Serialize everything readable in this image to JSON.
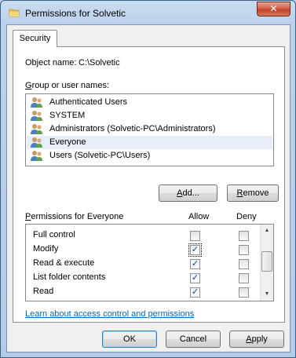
{
  "window": {
    "title": "Permissions for Solvetic",
    "close_glyph": "✕"
  },
  "tabs": [
    {
      "label": "Security"
    }
  ],
  "object": {
    "label": "Object name:",
    "value": "C:\\Solvetic"
  },
  "groups": {
    "label": "Group or user names:",
    "items": [
      {
        "label": "Authenticated Users",
        "icon": "users-icon",
        "selected": false
      },
      {
        "label": "SYSTEM",
        "icon": "users-icon",
        "selected": false
      },
      {
        "label": "Administrators (Solvetic-PC\\Administrators)",
        "icon": "users-icon",
        "selected": false
      },
      {
        "label": "Everyone",
        "icon": "users-icon",
        "selected": true
      },
      {
        "label": "Users (Solvetic-PC\\Users)",
        "icon": "users-icon",
        "selected": false
      }
    ]
  },
  "buttons": {
    "add": "Add...",
    "remove": "Remove",
    "ok": "OK",
    "cancel": "Cancel",
    "apply": "Apply"
  },
  "permissions": {
    "label": "Permissions for Everyone",
    "allow_header": "Allow",
    "deny_header": "Deny",
    "rows": [
      {
        "name": "Full control",
        "allow": false,
        "deny": false
      },
      {
        "name": "Modify",
        "allow": true,
        "deny": false
      },
      {
        "name": "Read & execute",
        "allow": true,
        "deny": false
      },
      {
        "name": "List folder contents",
        "allow": true,
        "deny": false
      },
      {
        "name": "Read",
        "allow": true,
        "deny": false
      }
    ]
  },
  "help_link": "Learn about access control and permissions",
  "check_glyph": "✓",
  "colors": {
    "accent": "#0066cc",
    "titlebar": "#bcd3ea",
    "close": "#c4412a"
  }
}
